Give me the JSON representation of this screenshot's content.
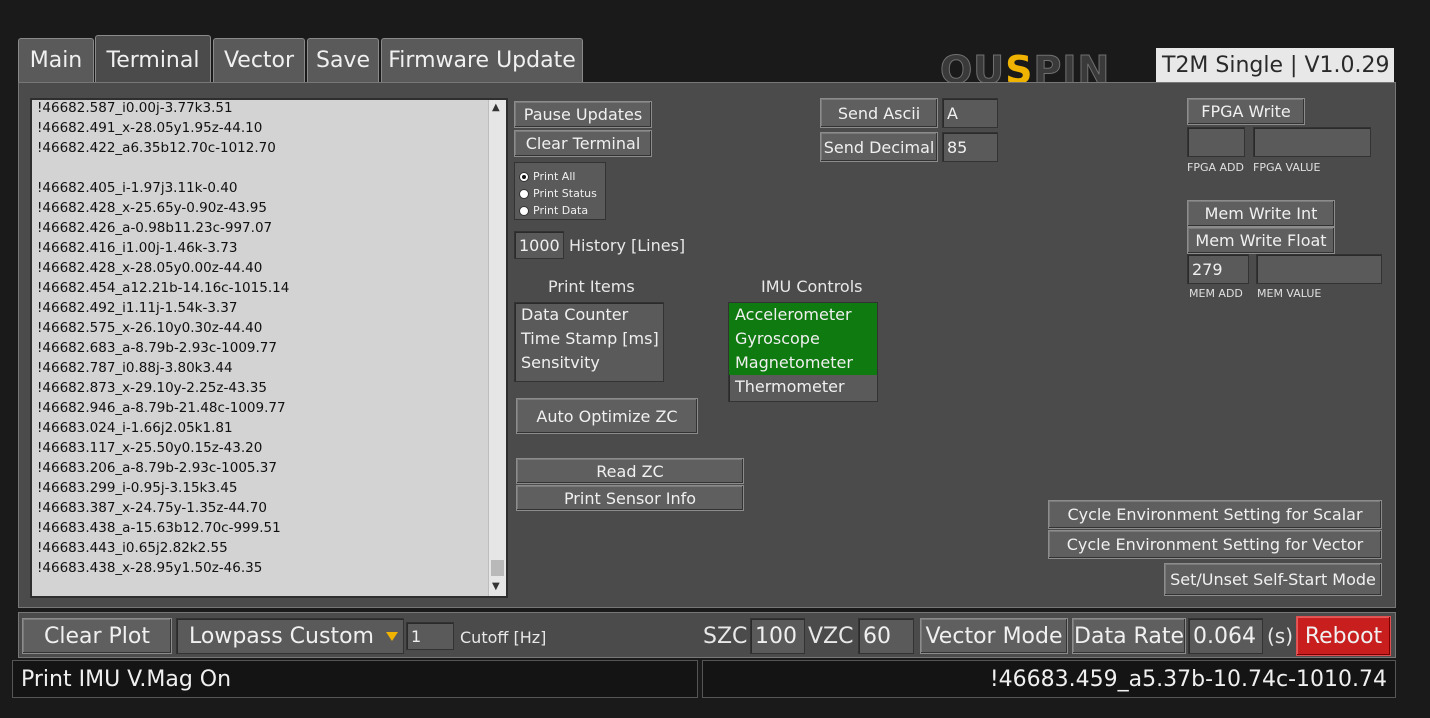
{
  "tabs": [
    "Main",
    "Terminal",
    "Vector",
    "Save",
    "Firmware Update"
  ],
  "logo": {
    "text_a": "QU",
    "text_s": "S",
    "text_b": "PIN"
  },
  "version": "T2M Single | V1.0.29",
  "terminal": {
    "lines": [
      "!46682.587_i0.00j-3.77k3.51",
      "!46682.491_x-28.05y1.95z-44.10",
      "!46682.422_a6.35b12.70c-1012.70",
      "",
      "!46682.405_i-1.97j3.11k-0.40",
      "!46682.428_x-25.65y-0.90z-43.95",
      "!46682.426_a-0.98b11.23c-997.07",
      "!46682.416_i1.00j-1.46k-3.73",
      "!46682.428_x-28.05y0.00z-44.40",
      "!46682.454_a12.21b-14.16c-1015.14",
      "!46682.492_i1.11j-1.54k-3.37",
      "!46682.575_x-26.10y0.30z-44.40",
      "!46682.683_a-8.79b-2.93c-1009.77",
      "!46682.787_i0.88j-3.80k3.44",
      "!46682.873_x-29.10y-2.25z-43.35",
      "!46682.946_a-8.79b-21.48c-1009.77",
      "!46683.024_i-1.66j2.05k1.81",
      "!46683.117_x-25.50y0.15z-43.20",
      "!46683.206_a-8.79b-2.93c-1005.37",
      "!46683.299_i-0.95j-3.15k3.45",
      "!46683.387_x-24.75y-1.35z-44.70",
      "!46683.438_a-15.63b12.70c-999.51",
      "!46683.443_i0.65j2.82k2.55",
      "!46683.438_x-28.95y1.50z-46.35"
    ]
  },
  "controls": {
    "pause_updates": "Pause Updates",
    "clear_terminal": "Clear Terminal",
    "radio_options": [
      "Print All",
      "Print Status",
      "Print Data"
    ],
    "radio_selected": "Print All",
    "history_value": "1000",
    "history_label": "History [Lines]",
    "print_items_label": "Print Items",
    "print_items": [
      "Data Counter",
      "Time Stamp [ms]",
      "Sensitvity"
    ],
    "imu_label": "IMU Controls",
    "imu_items": [
      "Accelerometer",
      "Gyroscope",
      "Magnetometer",
      "Thermometer"
    ],
    "imu_selected": [
      "Accelerometer",
      "Gyroscope",
      "Magnetometer"
    ],
    "auto_optimize": "Auto Optimize ZC",
    "read_zc": "Read ZC",
    "print_sensor_info": "Print Sensor Info",
    "send_ascii": "Send Ascii",
    "send_ascii_value": "A",
    "send_decimal": "Send Decimal",
    "send_decimal_value": "85",
    "fpga_write": "FPGA Write",
    "fpga_add_label": "FPGA ADD",
    "fpga_value_label": "FPGA VALUE",
    "fpga_add_value": "",
    "fpga_value_value": "",
    "mem_write_int": "Mem Write Int",
    "mem_write_float": "Mem Write Float",
    "mem_add_value": "279",
    "mem_value_value": "",
    "mem_add_label": "MEM ADD",
    "mem_value_label": "MEM VALUE",
    "cycle_scalar": "Cycle Environment Setting for Scalar",
    "cycle_vector": "Cycle Environment Setting for Vector",
    "self_start": "Set/Unset Self-Start Mode"
  },
  "bottom": {
    "clear_plot": "Clear Plot",
    "filter": "Lowpass Custom",
    "cutoff_value": "1",
    "cutoff_label": "Cutoff [Hz]",
    "szc_label": "SZC",
    "szc_value": "100",
    "vzc_label": "VZC",
    "vzc_value": "60",
    "vector_mode": "Vector Mode",
    "data_rate": "Data Rate",
    "data_rate_value": "0.064",
    "data_rate_unit": "(s)",
    "reboot": "Reboot"
  },
  "status": {
    "left": "Print IMU V.Mag On",
    "right": "!46683.459_a5.37b-10.74c-1010.74"
  },
  "colors": {
    "accent_green": "#0f7a0f",
    "reboot_red": "#c81e1e",
    "logo_orange": "#f0b400"
  }
}
